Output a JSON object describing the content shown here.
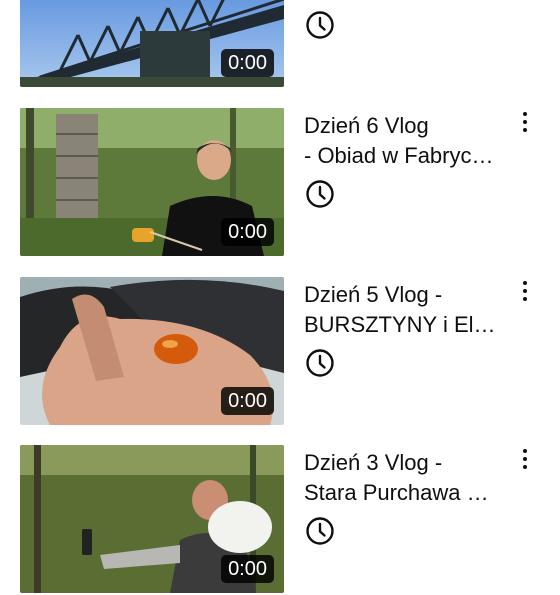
{
  "videos": [
    {
      "title": "",
      "duration": "0:00",
      "thumbnail": "railway-bridge"
    },
    {
      "title": "Dzień 6 Vlog\n- Obiad w Fabryc…",
      "duration": "0:00",
      "thumbnail": "man-in-forest-ruins"
    },
    {
      "title": "Dzień 5 Vlog -\nBURSZTYNY i El…",
      "duration": "0:00",
      "thumbnail": "amber-in-hand"
    },
    {
      "title": "Dzień 3 Vlog -\nStara Purchawa …",
      "duration": "0:00",
      "thumbnail": "man-with-puffball"
    }
  ],
  "icons": {
    "watch_later": "clock-icon",
    "more": "more-vert-icon"
  }
}
